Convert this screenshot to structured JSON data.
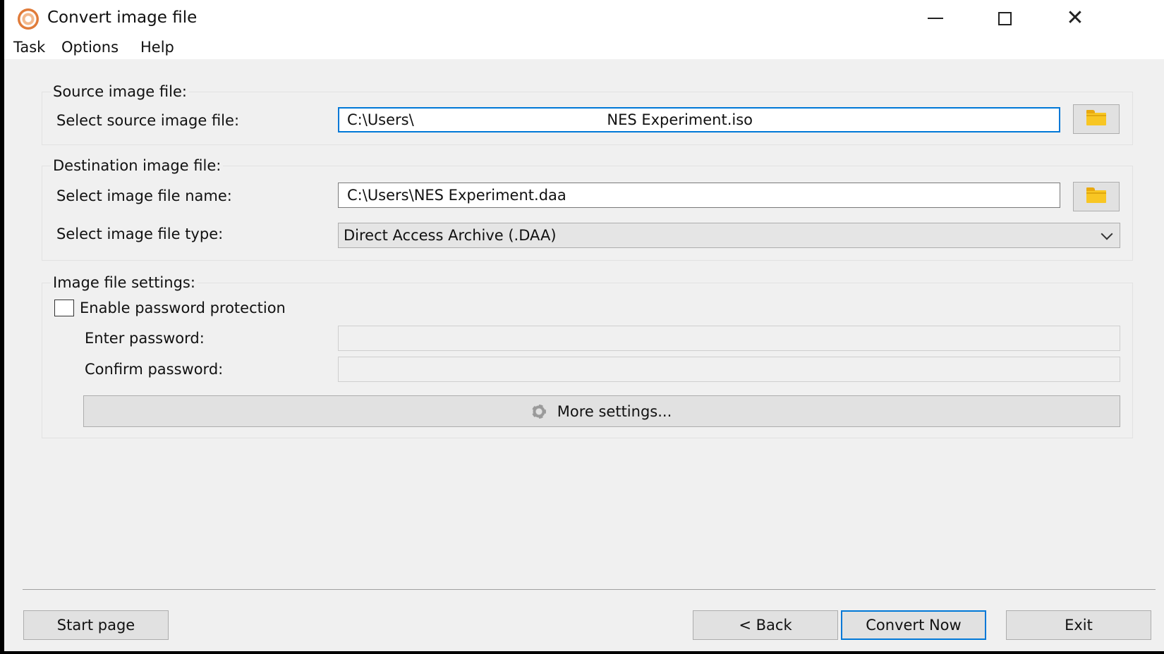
{
  "window": {
    "title": "Convert image file",
    "minimize_icon": "minimize-icon",
    "maximize_icon": "maximize-icon",
    "close_icon": "close-icon",
    "close_glyph": "✕"
  },
  "menu": [
    "Task",
    "Options",
    "Help"
  ],
  "source": {
    "group_title": "Source image file:",
    "label": "Select source image file:",
    "value": "C:\\Users\\                                         NES Experiment.iso",
    "browse_icon": "folder-icon"
  },
  "destination": {
    "group_title": "Destination image file:",
    "name_label": "Select image file name:",
    "name_value": "C:\\Users\\NES Experiment.daa",
    "type_label": "Select image file type:",
    "type_value": "Direct Access Archive (.DAA)",
    "browse_icon": "folder-icon"
  },
  "settings": {
    "group_title": "Image file settings:",
    "password_checkbox_label": "Enable password protection",
    "password_checkbox_checked": false,
    "enter_password_label": "Enter password:",
    "confirm_password_label": "Confirm password:",
    "more_settings_label": "More settings..."
  },
  "footer": {
    "start_page": "Start page",
    "back": "< Back",
    "convert_now": "Convert Now",
    "exit": "Exit"
  },
  "colors": {
    "accent": "#0078d7",
    "folder": "#f8c623"
  }
}
